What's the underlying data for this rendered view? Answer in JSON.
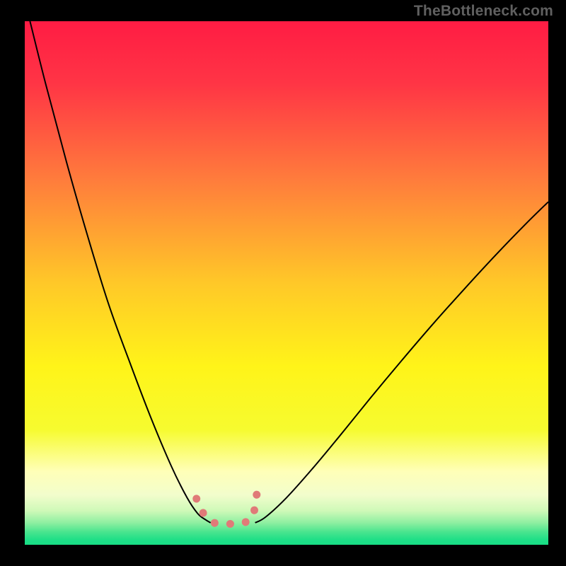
{
  "watermark": "TheBottleneck.com",
  "chart_data": {
    "type": "line",
    "title": "",
    "xlabel": "",
    "ylabel": "",
    "x_range": [
      0,
      100
    ],
    "y_range": [
      0,
      100
    ],
    "grid": false,
    "legend": false,
    "series": [
      {
        "name": "left-curve",
        "x": [
          1,
          4,
          8,
          12,
          16,
          20,
          24,
          28,
          31,
          33,
          34.5,
          35.5
        ],
        "y": [
          100,
          88,
          73,
          59,
          46,
          35,
          24.5,
          15,
          9,
          6,
          4.8,
          4.2
        ],
        "stroke": "#000000",
        "stroke_width": 2
      },
      {
        "name": "right-curve",
        "x": [
          44,
          46,
          50,
          55,
          60,
          66,
          72,
          78,
          84,
          90,
          96,
          100
        ],
        "y": [
          4.2,
          5.3,
          9.0,
          14.6,
          20.6,
          28.0,
          35.2,
          42.2,
          48.9,
          55.4,
          61.6,
          65.5
        ],
        "stroke": "#000000",
        "stroke_width": 2
      },
      {
        "name": "valley-marker",
        "x": [
          32.8,
          34.0,
          35.4,
          37.0,
          38.6,
          40.2,
          41.8,
          43.2,
          43.9,
          44.3
        ],
        "y": [
          8.8,
          6.2,
          4.6,
          4.0,
          4.0,
          4.0,
          4.2,
          5.0,
          6.8,
          9.6
        ],
        "stroke": "#E07A78",
        "stroke_width": 11,
        "linecap": "round",
        "dash": "0.1 22"
      }
    ],
    "background_gradient": {
      "type": "linear-vertical",
      "stops": [
        {
          "offset": 0.0,
          "color": "#FF1C44"
        },
        {
          "offset": 0.12,
          "color": "#FF3545"
        },
        {
          "offset": 0.3,
          "color": "#FF7B3C"
        },
        {
          "offset": 0.5,
          "color": "#FFC828"
        },
        {
          "offset": 0.66,
          "color": "#FFF419"
        },
        {
          "offset": 0.78,
          "color": "#F6FB2F"
        },
        {
          "offset": 0.86,
          "color": "#FFFFB8"
        },
        {
          "offset": 0.905,
          "color": "#F2FDCC"
        },
        {
          "offset": 0.935,
          "color": "#CFF9B8"
        },
        {
          "offset": 0.958,
          "color": "#8EEFA1"
        },
        {
          "offset": 0.975,
          "color": "#4BE58F"
        },
        {
          "offset": 0.99,
          "color": "#1FDF87"
        },
        {
          "offset": 1.0,
          "color": "#18DD85"
        }
      ]
    }
  }
}
